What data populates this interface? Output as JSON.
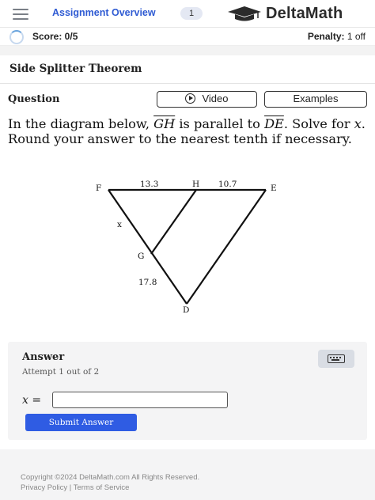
{
  "header": {
    "assignment_label": "Assignment Overview",
    "assignment_count": "1",
    "logo_text": "DeltaMath"
  },
  "scorebar": {
    "score": "Score: 0/5",
    "penalty_label": "Penalty:",
    "penalty_value": "1 off"
  },
  "problem": {
    "title": "Side Splitter Theorem",
    "question_label": "Question",
    "video_label": "Video",
    "examples_label": "Examples",
    "text_1": "In the diagram below, ",
    "segment_1": "GH",
    "text_2": " is parallel to ",
    "segment_2": "DE",
    "text_3": ". Solve for ",
    "variable": "x",
    "text_4": ". Round your answer to the nearest tenth if necessary."
  },
  "diagram": {
    "points": {
      "F": "F",
      "H": "H",
      "E": "E",
      "G": "G",
      "D": "D"
    },
    "labels": {
      "FH": "13.3",
      "HE": "10.7",
      "FG": "x",
      "GD": "17.8"
    }
  },
  "answer": {
    "title": "Answer",
    "attempt": "Attempt 1 out of 2",
    "variable": "x",
    "equals": "=",
    "input_value": "",
    "submit_label": "Submit Answer"
  },
  "footer": {
    "copyright": "Copyright ©2024 DeltaMath.com All Rights Reserved.",
    "privacy": "Privacy Policy",
    "separator": "|",
    "terms": "Terms of Service"
  },
  "colors": {
    "accent": "#2f5ce3",
    "link": "#2f5bd3"
  }
}
